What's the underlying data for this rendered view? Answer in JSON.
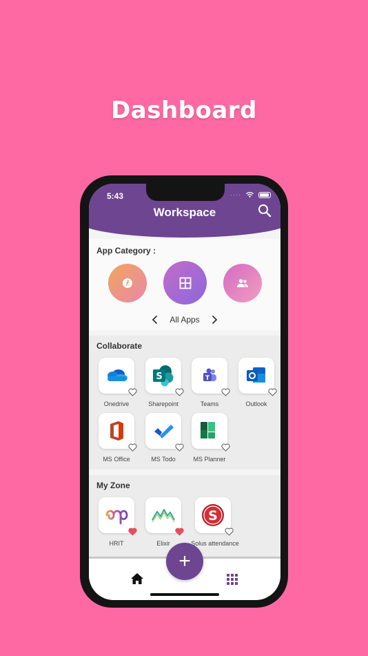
{
  "promo": {
    "title": "Dashboard"
  },
  "status": {
    "time": "5:43"
  },
  "header": {
    "title": "Workspace"
  },
  "category": {
    "title": "App Category :",
    "pager_label": "All Apps"
  },
  "collaborate": {
    "title": "Collaborate",
    "apps": [
      {
        "label": "Onedrive",
        "icon": "onedrive-icon"
      },
      {
        "label": "Sharepoint",
        "icon": "sharepoint-icon"
      },
      {
        "label": "Teams",
        "icon": "teams-icon"
      },
      {
        "label": "Outlook",
        "icon": "outlook-icon"
      },
      {
        "label": "MS Office",
        "icon": "office-icon"
      },
      {
        "label": "MS Todo",
        "icon": "todo-icon"
      },
      {
        "label": "MS Planner",
        "icon": "planner-icon"
      }
    ]
  },
  "myzone": {
    "title": "My Zone",
    "apps": [
      {
        "label": "HRIT",
        "icon": "hrit-icon",
        "favorite": true
      },
      {
        "label": "Elixir",
        "icon": "elixir-icon",
        "favorite": true
      },
      {
        "label": "Solus attendance",
        "icon": "solus-icon",
        "favorite": false
      }
    ]
  },
  "fab": {
    "label": "+"
  },
  "colors": {
    "background": "#ff69a3",
    "primary": "#6e4591",
    "favorite": "#e0505e"
  }
}
